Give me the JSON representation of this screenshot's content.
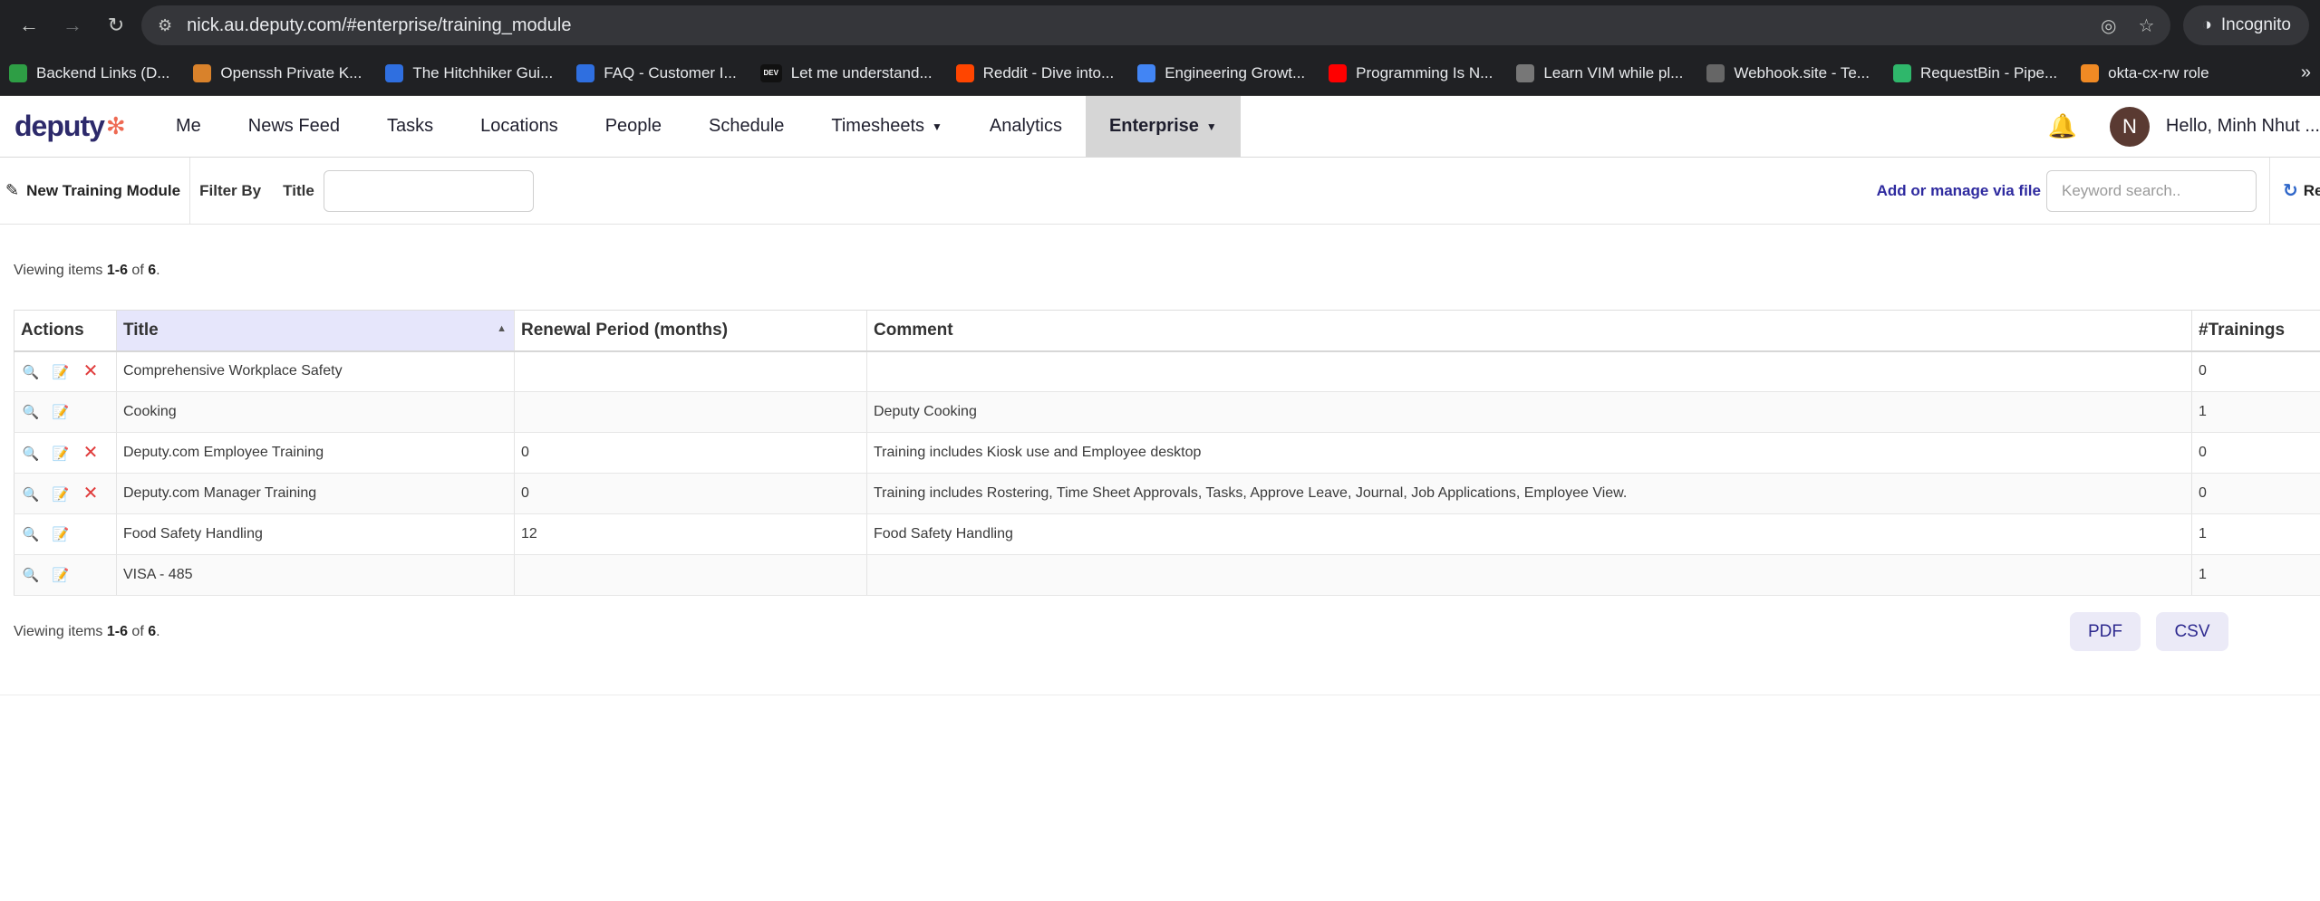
{
  "browser": {
    "url": "nick.au.deputy.com/#enterprise/training_module",
    "incognito_label": "Incognito",
    "bookmarks": [
      {
        "label": "Backend Links (D...",
        "color": "#2e9e45",
        "icon": "plus-square"
      },
      {
        "label": "Openssh Private K...",
        "color": "#d9822b",
        "icon": "tool"
      },
      {
        "label": "The Hitchhiker Gui...",
        "color": "#2f6fe0",
        "icon": "bolt"
      },
      {
        "label": "FAQ - Customer I...",
        "color": "#2f6fe0",
        "icon": "x-square"
      },
      {
        "label": "Let me understand...",
        "color": "#111111",
        "icon": "DEV"
      },
      {
        "label": "Reddit - Dive into...",
        "color": "#ff4500",
        "icon": "reddit"
      },
      {
        "label": "Engineering Growt...",
        "color": "#4285f4",
        "icon": "doc"
      },
      {
        "label": "Programming Is N...",
        "color": "#ff0000",
        "icon": "youtube"
      },
      {
        "label": "Learn VIM while pl...",
        "color": "#777777",
        "icon": "globe"
      },
      {
        "label": "Webhook.site - Te...",
        "color": "#666666",
        "icon": "webhook"
      },
      {
        "label": "RequestBin - Pipe...",
        "color": "#2fb76b",
        "icon": "p"
      },
      {
        "label": "okta-cx-rw role",
        "color": "#f08a24",
        "icon": "cube"
      }
    ],
    "more_label": "»"
  },
  "nav": {
    "logo": "deputy",
    "items": [
      "Me",
      "News Feed",
      "Tasks",
      "Locations",
      "People",
      "Schedule",
      "Timesheets",
      "Analytics",
      "Enterprise"
    ],
    "active": "Enterprise",
    "avatar_initial": "N",
    "greeting": "Hello, Minh Nhut ..."
  },
  "toolbar": {
    "new_label": "New Training Module",
    "filter_by": "Filter By",
    "title_label": "Title",
    "title_value": "",
    "manage_link": "Add or manage via file",
    "keyword_placeholder": "Keyword search..",
    "refresh_label": "Re"
  },
  "viewing": {
    "prefix": "Viewing items ",
    "range": "1-6",
    "of": " of ",
    "total": "6",
    "suffix": "."
  },
  "table": {
    "headers": [
      "Actions",
      "Title",
      "Renewal Period (months)",
      "Comment",
      "#Trainings"
    ],
    "rows": [
      {
        "title": "Comprehensive Workplace Safety",
        "renewal": "",
        "comment": "",
        "trainings": "0",
        "deletable": true
      },
      {
        "title": "Cooking",
        "renewal": "",
        "comment": "Deputy Cooking",
        "trainings": "1",
        "deletable": false
      },
      {
        "title": "Deputy.com Employee Training",
        "renewal": "0",
        "comment": "Training includes Kiosk use and Employee desktop",
        "trainings": "0",
        "deletable": true
      },
      {
        "title": "Deputy.com Manager Training",
        "renewal": "0",
        "comment": "Training includes Rostering, Time Sheet Approvals, Tasks, Approve Leave, Journal, Job Applications, Employee View.",
        "trainings": "0",
        "deletable": true
      },
      {
        "title": "Food Safety Handling",
        "renewal": "12",
        "comment": "Food Safety Handling",
        "trainings": "1",
        "deletable": false
      },
      {
        "title": "VISA - 485",
        "renewal": "",
        "comment": "",
        "trainings": "1",
        "deletable": false
      }
    ]
  },
  "export": {
    "pdf": "PDF",
    "csv": "CSV"
  }
}
